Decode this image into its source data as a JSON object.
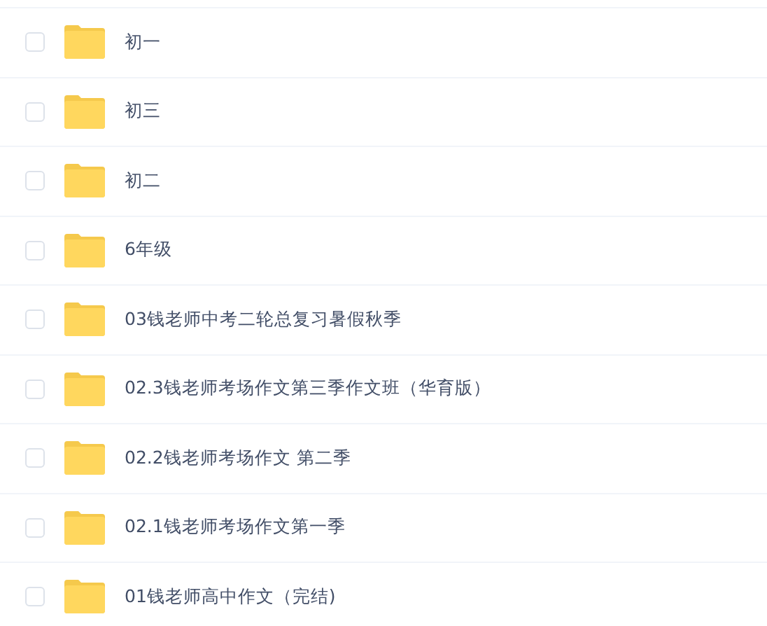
{
  "files": [
    {
      "name": "初一",
      "checked": false
    },
    {
      "name": "初三",
      "checked": false
    },
    {
      "name": "初二",
      "checked": false
    },
    {
      "name": "6年级",
      "checked": false
    },
    {
      "name": "03钱老师中考二轮总复习暑假秋季",
      "checked": false
    },
    {
      "name": "02.3钱老师考场作文第三季作文班（华育版）",
      "checked": false
    },
    {
      "name": "02.2钱老师考场作文 第二季",
      "checked": false
    },
    {
      "name": "02.1钱老师考场作文第一季",
      "checked": false
    },
    {
      "name": "01钱老师高中作文（完结)",
      "checked": false
    }
  ]
}
